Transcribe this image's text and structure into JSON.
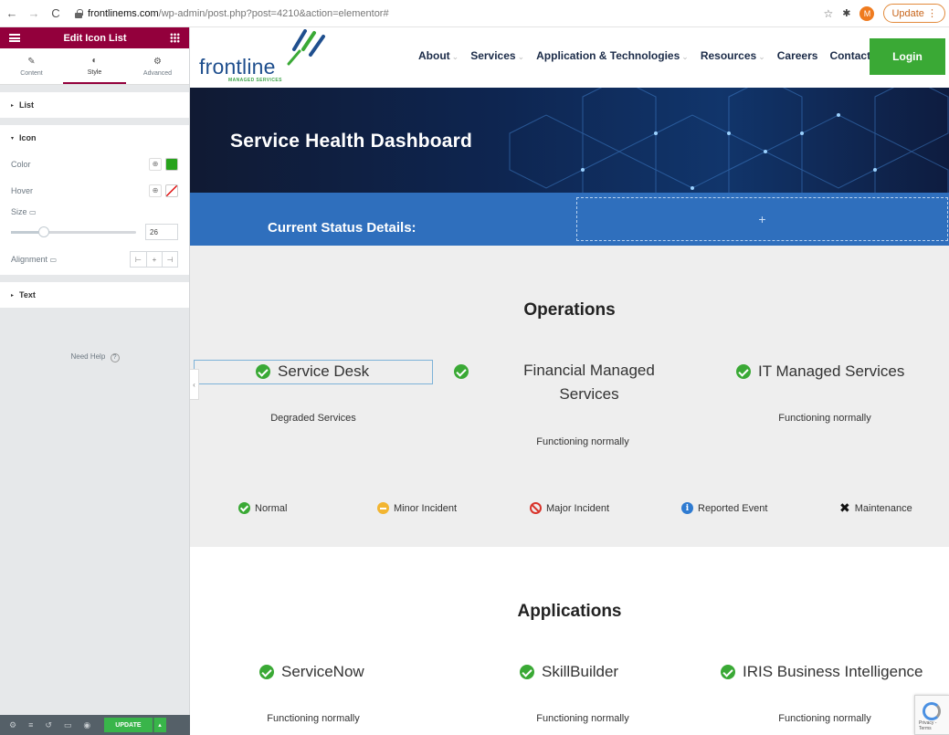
{
  "browser": {
    "url_domain": "frontlinems.com",
    "url_path": "/wp-admin/post.php?post=4210&action=elementor#",
    "avatar_letter": "M",
    "update_label": "Update"
  },
  "panel": {
    "title": "Edit Icon List",
    "tabs": [
      {
        "label": "Content",
        "icon": "pencil-icon"
      },
      {
        "label": "Style",
        "icon": "half-circle-icon"
      },
      {
        "label": "Advanced",
        "icon": "gear-icon"
      }
    ],
    "sections": {
      "list": "List",
      "icon": "Icon",
      "text": "Text"
    },
    "controls": {
      "color_label": "Color",
      "color_value": "#27a31c",
      "hover_label": "Hover",
      "size_label": "Size",
      "size_value": "26",
      "size_fraction": 0.26,
      "alignment_label": "Alignment"
    },
    "need_help": "Need Help",
    "update_button": "UPDATE"
  },
  "site": {
    "logo_text": "frontline",
    "logo_sub": "MANAGED SERVICES",
    "nav": [
      "About",
      "Services",
      "Application & Technologies",
      "Resources",
      "Careers",
      "Contact"
    ],
    "login": "Login",
    "hero_title": "Service Health Dashboard",
    "status_title": "Current Status Details:",
    "drop_plus": "+",
    "operations": {
      "title": "Operations",
      "services": [
        {
          "name": "Service Desk",
          "status": "Degraded Services"
        },
        {
          "name": "Financial Managed Services",
          "status": "Functioning normally"
        },
        {
          "name": "IT Managed Services",
          "status": "Functioning normally"
        }
      ],
      "legend": [
        "Normal",
        "Minor Incident",
        "Major Incident",
        "Reported Event",
        "Maintenance"
      ]
    },
    "applications": {
      "title": "Applications",
      "services": [
        {
          "name": "ServiceNow",
          "status": "Functioning normally"
        },
        {
          "name": "SkillBuilder",
          "status": "Functioning normally"
        },
        {
          "name": "IRIS Business Intelligence",
          "status": "Functioning normally"
        }
      ]
    },
    "recaptcha_text": "Privacy - Terms"
  }
}
